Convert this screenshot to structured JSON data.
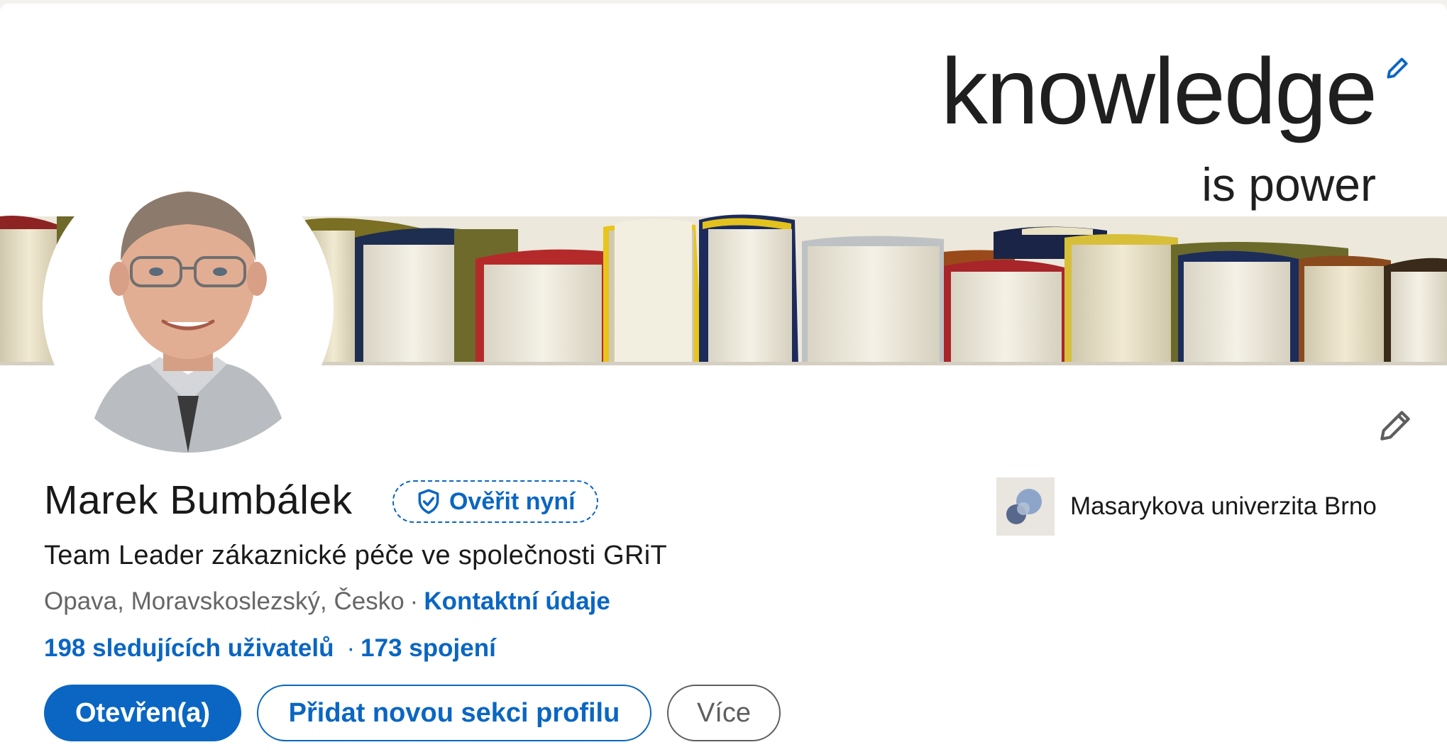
{
  "banner": {
    "headline": "knowledge",
    "subheadline": "is power"
  },
  "profile": {
    "name": "Marek Bumbálek",
    "verify_label": "Ověřit nyní",
    "headline": "Team Leader zákaznické péče ve společnosti GRiT",
    "location": "Opava, Moravskoslezský, Česko",
    "separator": "·",
    "contact_label": "Kontaktní údaje",
    "followers_label": "198 sledujících uživatelů",
    "connections_label": "173 spojení"
  },
  "organization": {
    "name": "Masarykova univerzita Brno"
  },
  "actions": {
    "open_label": "Otevřen(a)",
    "add_section_label": "Přidat novou sekci profilu",
    "more_label": "Více"
  },
  "colors": {
    "accent": "#0a66c2",
    "text": "#191919",
    "muted": "#666666"
  },
  "icons": {
    "banner_edit": "pencil-icon",
    "intro_edit": "pencil-icon",
    "verify": "shield-check-icon"
  }
}
